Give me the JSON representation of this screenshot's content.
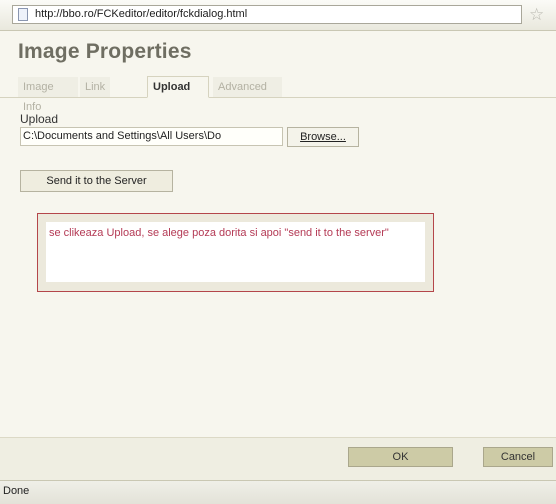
{
  "browser": {
    "url": "http://bbo.ro/FCKeditor/editor/fckdialog.html",
    "status": "Done",
    "icons": {
      "page": "page-icon",
      "bookmark": "star-icon"
    }
  },
  "dialog": {
    "title": "Image Properties",
    "tabs": [
      {
        "label": "Image Info",
        "active": false
      },
      {
        "label": "Link",
        "active": false
      },
      {
        "label": "Upload",
        "active": true
      },
      {
        "label": "Advanced",
        "active": false
      }
    ]
  },
  "upload": {
    "label": "Upload",
    "file_value": "C:\\Documents and Settings\\All Users\\Do",
    "browse_label": "Browse...",
    "send_label": "Send it to the Server"
  },
  "annotation": {
    "text": "se clikeaza Upload, se alege poza dorita si apoi \"send it to the server\"",
    "color": "#b43a55",
    "border_color": "#b4464a"
  },
  "footer": {
    "ok_label": "OK",
    "cancel_label": "Cancel"
  }
}
